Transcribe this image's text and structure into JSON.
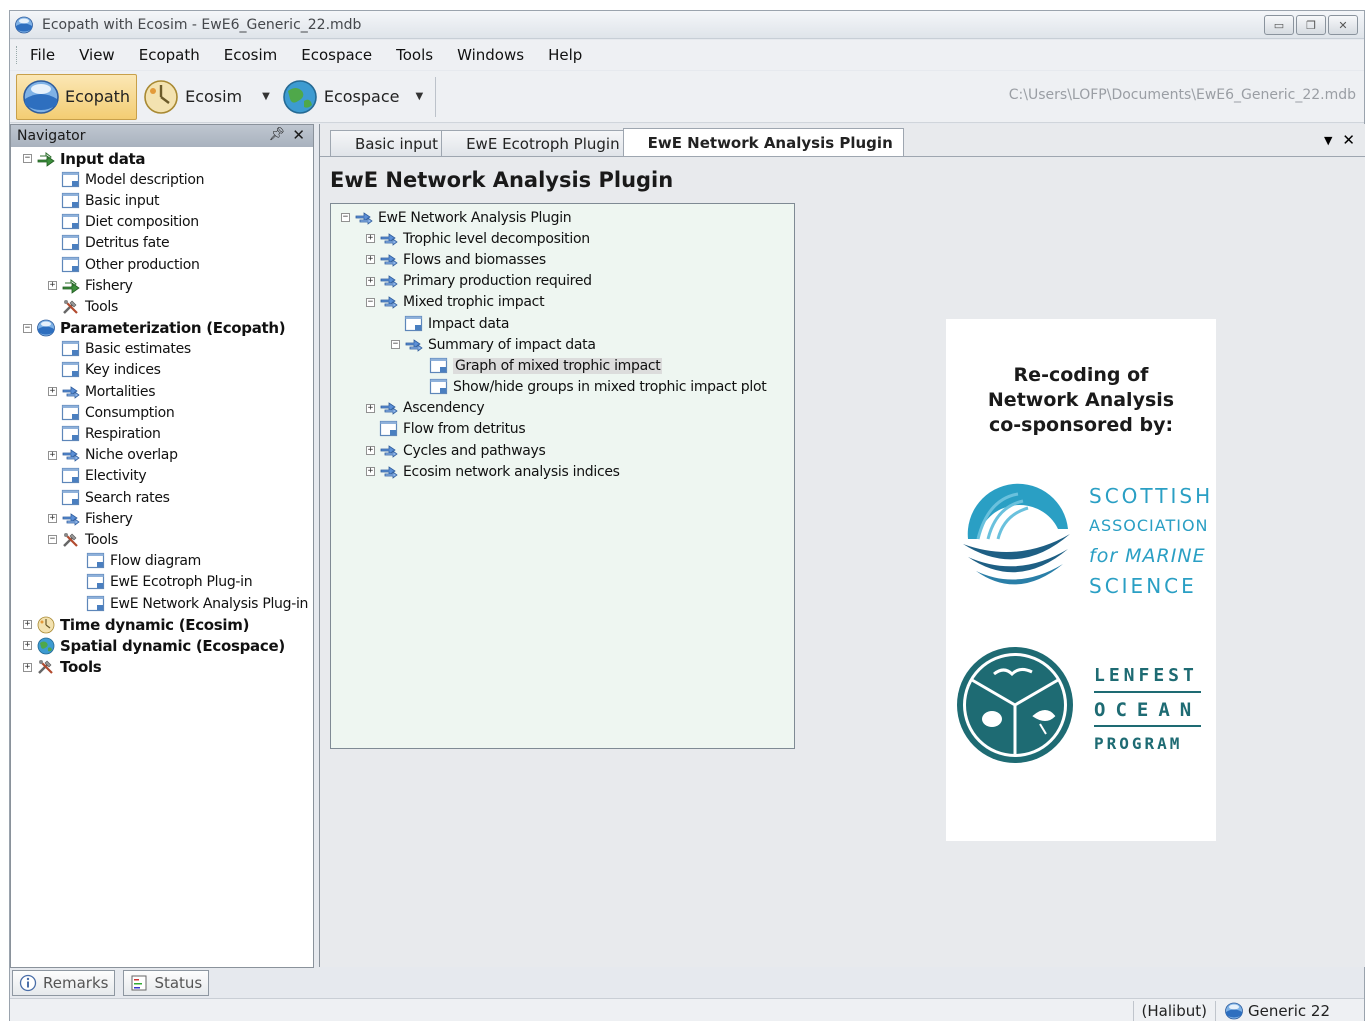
{
  "window": {
    "title": "Ecopath with Ecosim - EwE6_Generic_22.mdb"
  },
  "menu": [
    "File",
    "View",
    "Ecopath",
    "Ecosim",
    "Ecospace",
    "Tools",
    "Windows",
    "Help"
  ],
  "toolbar": {
    "ecopath_label": "Ecopath",
    "ecosim_label": "Ecosim",
    "ecospace_label": "Ecospace",
    "path": "C:\\Users\\LOFP\\Documents\\EwE6_Generic_22.mdb"
  },
  "navigator": {
    "title": "Navigator",
    "items": [
      {
        "label": "Input data",
        "level": 0,
        "bold": true,
        "expander": "−",
        "icon": "arrow-icon"
      },
      {
        "label": "Model description",
        "level": 1,
        "icon": "form-icon"
      },
      {
        "label": "Basic input",
        "level": 1,
        "icon": "form-icon"
      },
      {
        "label": "Diet composition",
        "level": 1,
        "icon": "form-icon"
      },
      {
        "label": "Detritus fate",
        "level": 1,
        "icon": "form-icon"
      },
      {
        "label": "Other production",
        "level": 1,
        "icon": "form-icon"
      },
      {
        "label": "Fishery",
        "level": 1,
        "expander": "+",
        "icon": "arrow-icon"
      },
      {
        "label": "Tools",
        "level": 1,
        "icon": "tools-icon"
      },
      {
        "label": "Parameterization (Ecopath)",
        "level": 0,
        "bold": true,
        "expander": "−",
        "icon": "ecopath-icon"
      },
      {
        "label": "Basic estimates",
        "level": 1,
        "icon": "form-icon"
      },
      {
        "label": "Key indices",
        "level": 1,
        "icon": "form-icon"
      },
      {
        "label": "Mortalities",
        "level": 1,
        "expander": "+",
        "icon": "arrows-icon"
      },
      {
        "label": "Consumption",
        "level": 1,
        "icon": "form-icon"
      },
      {
        "label": "Respiration",
        "level": 1,
        "icon": "form-icon"
      },
      {
        "label": "Niche overlap",
        "level": 1,
        "expander": "+",
        "icon": "arrows-icon"
      },
      {
        "label": "Electivity",
        "level": 1,
        "icon": "form-icon"
      },
      {
        "label": "Search rates",
        "level": 1,
        "icon": "form-icon"
      },
      {
        "label": "Fishery",
        "level": 1,
        "expander": "+",
        "icon": "arrows-icon"
      },
      {
        "label": "Tools",
        "level": 1,
        "expander": "−",
        "icon": "tools-icon"
      },
      {
        "label": "Flow diagram",
        "level": 2,
        "icon": "form-icon"
      },
      {
        "label": "EwE Ecotroph Plug-in",
        "level": 2,
        "icon": "form-icon"
      },
      {
        "label": "EwE Network Analysis Plug-in",
        "level": 2,
        "icon": "form-icon"
      },
      {
        "label": "Time dynamic (Ecosim)",
        "level": 0,
        "bold": true,
        "expander": "+",
        "icon": "ecosim-icon"
      },
      {
        "label": "Spatial dynamic  (Ecospace)",
        "level": 0,
        "bold": true,
        "expander": "+",
        "icon": "ecospace-icon"
      },
      {
        "label": "Tools",
        "level": 0,
        "bold": true,
        "expander": "+",
        "icon": "tools-icon"
      }
    ]
  },
  "tabs": [
    {
      "label": "Basic input",
      "active": false
    },
    {
      "label": "EwE Ecotroph Plugin",
      "active": false
    },
    {
      "label": "EwE Network Analysis Plugin",
      "active": true
    }
  ],
  "plugin": {
    "title": "EwE Network Analysis Plugin",
    "tree": [
      {
        "label": "EwE Network Analysis Plugin",
        "level": 0,
        "expander": "−",
        "icon": "arrows-icon"
      },
      {
        "label": "Trophic level decomposition",
        "level": 1,
        "expander": "+",
        "icon": "arrows-icon"
      },
      {
        "label": "Flows and biomasses",
        "level": 1,
        "expander": "+",
        "icon": "arrows-icon"
      },
      {
        "label": "Primary production required",
        "level": 1,
        "expander": "+",
        "icon": "arrows-icon"
      },
      {
        "label": "Mixed trophic impact",
        "level": 1,
        "expander": "−",
        "icon": "arrows-icon"
      },
      {
        "label": "Impact data",
        "level": 2,
        "icon": "form-icon"
      },
      {
        "label": "Summary of impact data",
        "level": 2,
        "expander": "−",
        "icon": "arrows-icon"
      },
      {
        "label": "Graph of mixed trophic impact",
        "level": 3,
        "icon": "form-icon",
        "selected": true
      },
      {
        "label": "Show/hide groups in mixed trophic impact plot",
        "level": 3,
        "icon": "form-icon"
      },
      {
        "label": "Ascendency",
        "level": 1,
        "expander": "+",
        "icon": "arrows-icon"
      },
      {
        "label": "Flow from detritus",
        "level": 1,
        "icon": "form-icon"
      },
      {
        "label": "Cycles and pathways",
        "level": 1,
        "expander": "+",
        "icon": "arrows-icon"
      },
      {
        "label": "Ecosim network analysis indices",
        "level": 1,
        "expander": "+",
        "icon": "arrows-icon"
      }
    ]
  },
  "sponsor": {
    "line1": "Re-coding of",
    "line2": "Network Analysis",
    "line3": "co-sponsored by:",
    "sams": [
      "SCOTTISH",
      "ASSOCIATION",
      "for MARINE",
      "SCIENCE"
    ],
    "lenfest": [
      "LENFEST",
      "OCEAN",
      "PROGRAM"
    ]
  },
  "bottom_tabs": {
    "remarks": "Remarks",
    "status": "Status"
  },
  "statusbar": {
    "group": "(Halibut)",
    "model": "Generic 22"
  },
  "colors": {
    "sams_blue": "#2a9fc4",
    "lenfest_teal": "#1e6b73",
    "toolbar_active": "#f3cd73"
  }
}
